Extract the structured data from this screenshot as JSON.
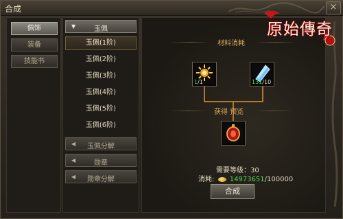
{
  "window": {
    "title": "合成",
    "close_label": "×"
  },
  "logo": {
    "text": "原始傳奇"
  },
  "categories": [
    {
      "label": "佩饰",
      "active": true
    },
    {
      "label": "装备",
      "active": false
    },
    {
      "label": "技能书",
      "active": false
    }
  ],
  "recipe_groups": [
    {
      "label": "玉佩",
      "expanded": true,
      "items": [
        {
          "label": "玉佩(1阶)",
          "selected": true
        },
        {
          "label": "玉佩(2阶)",
          "selected": false
        },
        {
          "label": "玉佩(3阶)",
          "selected": false
        },
        {
          "label": "玉佩(4阶)",
          "selected": false
        },
        {
          "label": "玉佩(5阶)",
          "selected": false
        },
        {
          "label": "玉佩(6阶)",
          "selected": false
        }
      ]
    },
    {
      "label": "玉佩分解",
      "expanded": false
    },
    {
      "label": "勋章",
      "expanded": false
    },
    {
      "label": "勋章分解",
      "expanded": false
    }
  ],
  "materials": {
    "heading": "材料消耗",
    "items": [
      {
        "icon": "sun-emblem-icon",
        "have": "1",
        "need": "/1"
      },
      {
        "icon": "blue-crystal-icon",
        "have": "131",
        "need": "/10"
      }
    ]
  },
  "preview": {
    "heading": "获得 预览",
    "icon": "red-jade-pendant-icon"
  },
  "requirement": {
    "text": "需要等级：30"
  },
  "cost": {
    "label": "消耗:",
    "have": "14973651",
    "need": "/100000"
  },
  "craft_button": {
    "label": "合成"
  },
  "colors": {
    "accent": "#d9a85a",
    "enough": "#4fdc4f",
    "connector": "#b07a2a"
  }
}
